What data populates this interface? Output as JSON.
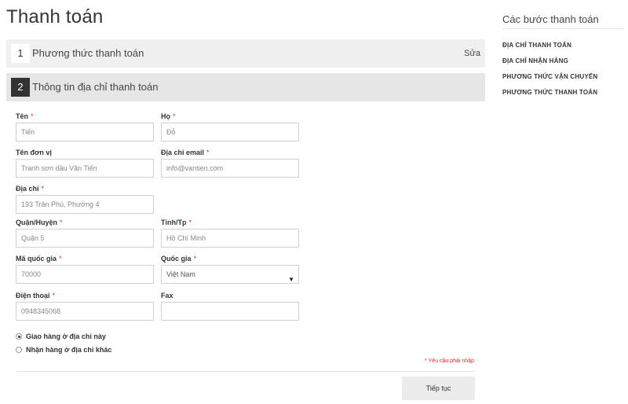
{
  "page": {
    "title": "Thanh toán"
  },
  "steps": [
    {
      "number": "1",
      "title": "Phương thức thanh toán",
      "edit_label": "Sửa"
    },
    {
      "number": "2",
      "title": "Thông tin địa chỉ thanh toán"
    }
  ],
  "form": {
    "first_name": {
      "label": "Tên",
      "required": "*",
      "value": "",
      "placeholder": "Tiến"
    },
    "last_name": {
      "label": "Họ",
      "required": "*",
      "value": "",
      "placeholder": "Đỗ"
    },
    "company": {
      "label": "Tên đơn vị",
      "value": "",
      "placeholder": "Tranh sơn dầu Văn Tiến"
    },
    "email": {
      "label": "Địa chỉ email",
      "required": "*",
      "value": "",
      "placeholder": "info@vantien.com"
    },
    "address": {
      "label": "Địa chỉ",
      "required": "*",
      "value": "",
      "placeholder": "193 Trần Phú, Phường 4"
    },
    "district": {
      "label": "Quận/Huyện",
      "required": "*",
      "value": "",
      "placeholder": "Quận 5"
    },
    "province": {
      "label": "Tỉnh/Tp",
      "required": "*",
      "value": "",
      "placeholder": "Hồ Chí Minh"
    },
    "postal_code": {
      "label": "Mã quốc gia",
      "required": "*",
      "value": "",
      "placeholder": "70000"
    },
    "country": {
      "label": "Quốc gia",
      "required": "*",
      "selected": "Việt Nam",
      "arrow": "▼"
    },
    "phone": {
      "label": "Điện thoại",
      "required": "*",
      "value": "",
      "placeholder": "0948345068"
    },
    "fax": {
      "label": "Fax",
      "value": "",
      "placeholder": ""
    },
    "shipping_options": [
      {
        "label": "Giao hàng ở địa chỉ này",
        "checked": true
      },
      {
        "label": "Nhận hàng ở địa chỉ khác",
        "checked": false
      }
    ],
    "required_note": "* Yêu cầu phải nhập",
    "continue_label": "Tiếp tục"
  },
  "sidebar": {
    "title": "Các bước thanh toán",
    "items": [
      {
        "label": "ĐỊA CHỈ THANH TOÁN"
      },
      {
        "label": "ĐỊA CHỈ NHẬN HÀNG"
      },
      {
        "label": "PHƯƠNG THỨC VẬN CHUYỂN"
      },
      {
        "label": "PHƯƠNG THỨC THANH TOÁN"
      }
    ]
  }
}
